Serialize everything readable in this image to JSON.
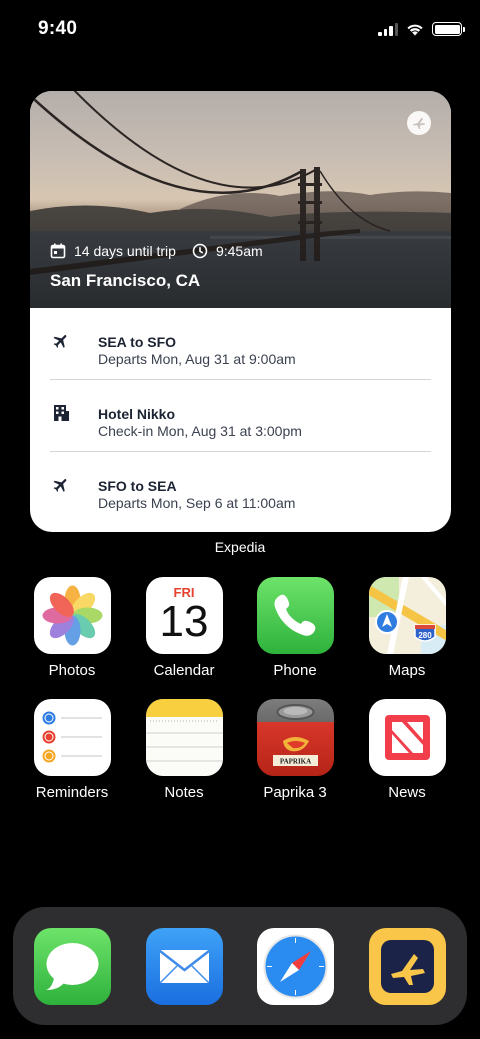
{
  "status_bar": {
    "time": "9:40"
  },
  "widget": {
    "app": "Expedia",
    "countdown": "14 days until trip",
    "time": "9:45am",
    "city": "San Francisco, CA",
    "items": [
      {
        "icon": "plane-icon",
        "title": "SEA to SFO",
        "subtitle": "Departs Mon, Aug 31 at 9:00am"
      },
      {
        "icon": "hotel-icon",
        "title": "Hotel Nikko",
        "subtitle": "Check-in Mon, Aug 31 at 3:00pm"
      },
      {
        "icon": "plane-icon",
        "title": "SFO to SEA",
        "subtitle": "Departs Mon, Sep 6 at 11:00am"
      }
    ]
  },
  "apps": [
    {
      "name": "Photos",
      "icon": "photos-icon"
    },
    {
      "name": "Calendar",
      "icon": "calendar-icon",
      "weekday": "FRI",
      "day": "13"
    },
    {
      "name": "Phone",
      "icon": "phone-icon"
    },
    {
      "name": "Maps",
      "icon": "maps-icon",
      "route_shield": "280"
    },
    {
      "name": "Reminders",
      "icon": "reminders-icon"
    },
    {
      "name": "Notes",
      "icon": "notes-icon"
    },
    {
      "name": "Paprika 3",
      "icon": "paprika-icon",
      "banner": "PAPRIKA"
    },
    {
      "name": "News",
      "icon": "news-icon"
    }
  ],
  "dock": [
    {
      "name": "Messages",
      "icon": "messages-icon"
    },
    {
      "name": "Mail",
      "icon": "mail-icon"
    },
    {
      "name": "Safari",
      "icon": "safari-icon"
    },
    {
      "name": "Expedia",
      "icon": "expedia-icon"
    }
  ]
}
